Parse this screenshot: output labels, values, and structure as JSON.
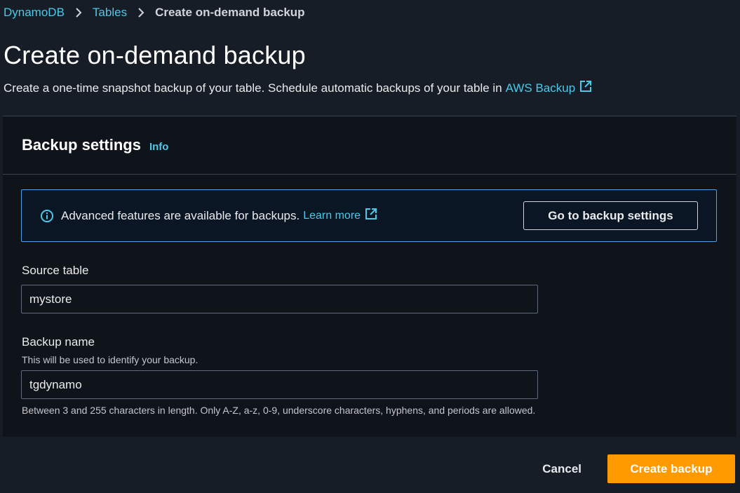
{
  "breadcrumb": {
    "items": [
      "DynamoDB",
      "Tables"
    ],
    "current": "Create on-demand backup"
  },
  "page": {
    "title": "Create on-demand backup",
    "description": "Create a one-time snapshot backup of your table. Schedule automatic backups of your table in",
    "aws_backup_link": "AWS Backup"
  },
  "backup_settings": {
    "heading": "Backup settings",
    "info_label": "Info",
    "alert": {
      "text": "Advanced features are available for backups.",
      "learn_more": "Learn more",
      "button_label": "Go to backup settings"
    },
    "source_table": {
      "label": "Source table",
      "value": "mystore"
    },
    "backup_name": {
      "label": "Backup name",
      "description": "This will be used to identify your backup.",
      "value": "tgdynamo",
      "constraint": "Between 3 and 255 characters in length. Only A-Z, a-z, 0-9, underscore characters, hyphens, and periods are allowed."
    }
  },
  "actions": {
    "cancel": "Cancel",
    "create": "Create backup"
  },
  "icons": {
    "separator": "chevron-right-icon",
    "external": "external-link-icon",
    "info": "info-circle-icon"
  },
  "colors": {
    "background": "#161d26",
    "panel": "#0f141a",
    "link": "#4cc9e8",
    "primary": "#ff9900",
    "alert_border": "#539fe5"
  }
}
